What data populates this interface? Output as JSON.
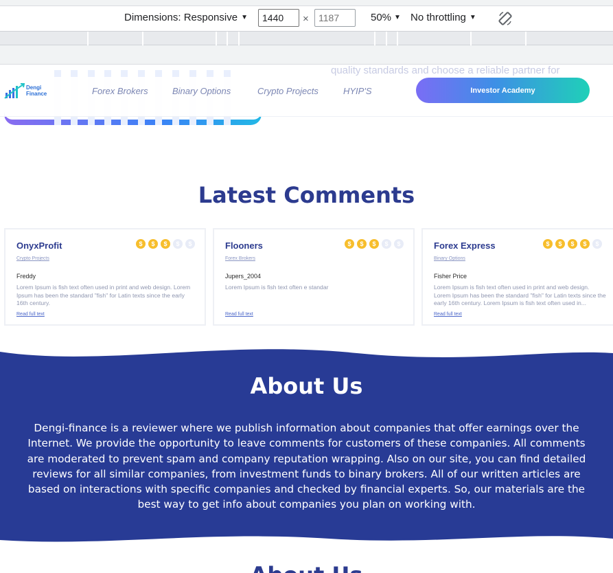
{
  "devtools": {
    "dimensions_label": "Dimensions: Responsive",
    "width_value": "1440",
    "height_placeholder": "1187",
    "times_sign": "×",
    "zoom": "50%",
    "throttling": "No throttling",
    "caret": "▼"
  },
  "site": {
    "faded_hero_text": "quality standards and choose a reliable partner for",
    "logo": {
      "line1": "Dengi",
      "line2": "Finance"
    },
    "nav": [
      "Forex Brokers",
      "Binary Options",
      "Crypto Projects",
      "HYIP'S"
    ],
    "cta": "Investor Academy",
    "latest_title": "Latest Comments",
    "comments": [
      {
        "company": "OnyxProfit",
        "category": "Crypto Projects",
        "rating": 3,
        "author": "Freddy",
        "text": "Lorem Ipsum is fish text often used in print and web design. Lorem Ipsum has been the standard \"fish\" for Latin texts since the early 16th century.",
        "link": "Read full text"
      },
      {
        "company": "Flooners",
        "category": "Forex Brokers",
        "rating": 3,
        "author": "Jupers_2004",
        "text": "Lorem Ipsum is fish text often e standar",
        "link": "Read full text"
      },
      {
        "company": "Forex Express",
        "category": "Binary Options",
        "rating": 4,
        "author": "Fisher Price",
        "text": "Lorem Ipsum is fish text often used in print and web design. Lorem Ipsum has been the standard \"fish\" for Latin texts since the early 16th century. Lorem Ipsum is fish text often used in...",
        "link": "Read full text"
      }
    ],
    "rating_max": 5,
    "coin_symbol": "$",
    "about_title": "About Us",
    "about_text": "Dengi-finance is a reviewer where we publish information about companies that offer earnings over the Internet. We provide the opportunity to leave comments for customers of these companies. All comments are moderated to prevent spam and company reputation wrapping. Also on our site, you can find detailed reviews for all similar companies, from investment funds to binary brokers. All of our written articles are based on interactions with specific companies and checked by financial experts. So, our materials are the best way to get info about companies you plan on working with.",
    "next_title": "About Us"
  },
  "colors": {
    "brand_navy": "#2c3b8f",
    "about_bg": "#283b95",
    "coin_gold": "#f7be2c",
    "cta_gradient_start": "#7a6df5",
    "cta_gradient_end": "#1fd0b8"
  },
  "icons": {
    "rotate": "rotate-icon",
    "logo": "bar-chart-logo-icon",
    "coin": "dollar-coin-icon"
  }
}
